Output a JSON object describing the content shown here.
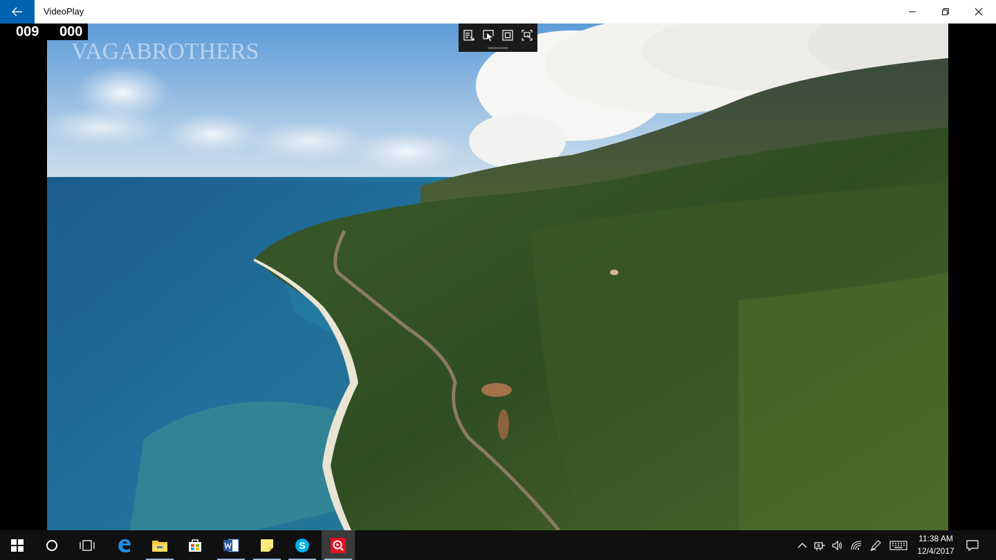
{
  "window": {
    "title": "VideoPlay",
    "accent": "#0063b1",
    "buttons": {
      "back": "back-arrow-icon",
      "minimize": "minimize-icon",
      "maximize": "restore-icon",
      "close": "close-icon"
    }
  },
  "video": {
    "counter_left": "009",
    "counter_right": "000",
    "watermark": "VAGABROTHERS"
  },
  "floating_toolbar": {
    "tools": [
      "edit-frame-icon",
      "select-region-icon",
      "fit-screen-icon",
      "compare-frame-icon"
    ]
  },
  "taskbar": {
    "pinned": [
      {
        "icon": "windows-start-icon"
      },
      {
        "icon": "cortana-search-icon"
      },
      {
        "icon": "task-view-icon"
      },
      {
        "icon": "edge-browser-icon"
      },
      {
        "icon": "file-explorer-icon"
      },
      {
        "icon": "store-icon"
      },
      {
        "icon": "word-icon"
      },
      {
        "icon": "sticky-notes-icon"
      },
      {
        "icon": "skype-icon"
      },
      {
        "icon": "videoplay-app-icon"
      }
    ],
    "tray_icons": [
      "chevron-up-icon",
      "network-adapter-icon",
      "volume-icon",
      "wifi-icon",
      "pen-icon",
      "keyboard-icon"
    ],
    "time": "11:38 AM",
    "date": "12/4/2017",
    "notification_icon": "action-center-icon"
  }
}
